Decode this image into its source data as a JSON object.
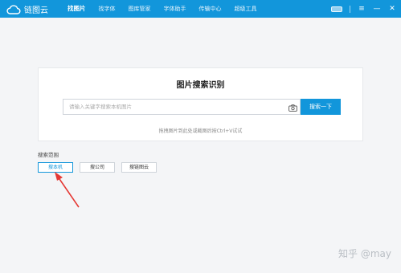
{
  "app": {
    "logo_text": "链图云"
  },
  "nav": {
    "items": [
      {
        "label": "找图片",
        "active": true
      },
      {
        "label": "找字体",
        "active": false
      },
      {
        "label": "图库管家",
        "active": false
      },
      {
        "label": "字体助手",
        "active": false
      },
      {
        "label": "传输中心",
        "active": false
      },
      {
        "label": "超级工具",
        "active": false
      }
    ]
  },
  "window_controls": {
    "menu": "≡",
    "minimize": "—",
    "close": "✕"
  },
  "search": {
    "title": "图片搜索识别",
    "placeholder": "请输入关键字搜索本机图片",
    "button_label": "搜索一下",
    "drop_hint": "拖拽图片到此处或截图后按Ctrl+V试试"
  },
  "scope": {
    "label": "搜索范围",
    "options": [
      {
        "label": "搜本机",
        "selected": true
      },
      {
        "label": "搜公司",
        "selected": false
      },
      {
        "label": "搜链图云",
        "selected": false
      }
    ]
  },
  "watermark": "知乎 @may",
  "colors": {
    "accent": "#1296db",
    "annotation_arrow": "#e53935"
  },
  "icons": {
    "logo": "cloud-icon",
    "camera": "camera-icon",
    "skin": "skin-icon"
  }
}
